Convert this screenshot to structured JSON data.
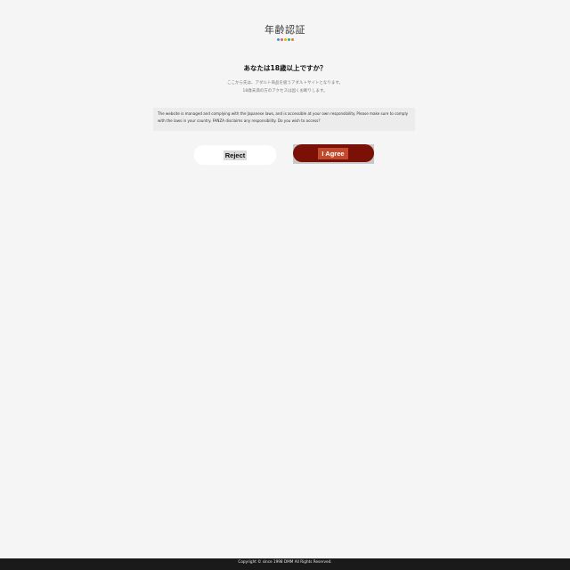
{
  "header": {
    "title": "年齢認証",
    "dot_colors": [
      "#4a90d9",
      "#e05b7a",
      "#f0b400",
      "#2faf73",
      "#e07b39"
    ]
  },
  "question": "あなたは18歳以上ですか？",
  "subtext": {
    "line1": "ここから先は、アダルト商品を扱うアダルトサイトとなります。",
    "line2": "18歳未満の方のアクセスは固くお断りします。"
  },
  "notice": "The website is managed and complying with the Japanese laws, and is accessible at your own responsibility. Please make sure to comply with the laws in your country. FANZA disclaims any responsibility. Do you wish to access?",
  "buttons": {
    "reject": "Reject",
    "agree": "I Agree"
  },
  "footer": {
    "copyright": "Copyright © since 1998 DMM All Rights Reserved."
  },
  "colors": {
    "agree_bg": "#7a1006",
    "background": "#f5f5f5",
    "footer_bg": "#1a1a1a"
  }
}
